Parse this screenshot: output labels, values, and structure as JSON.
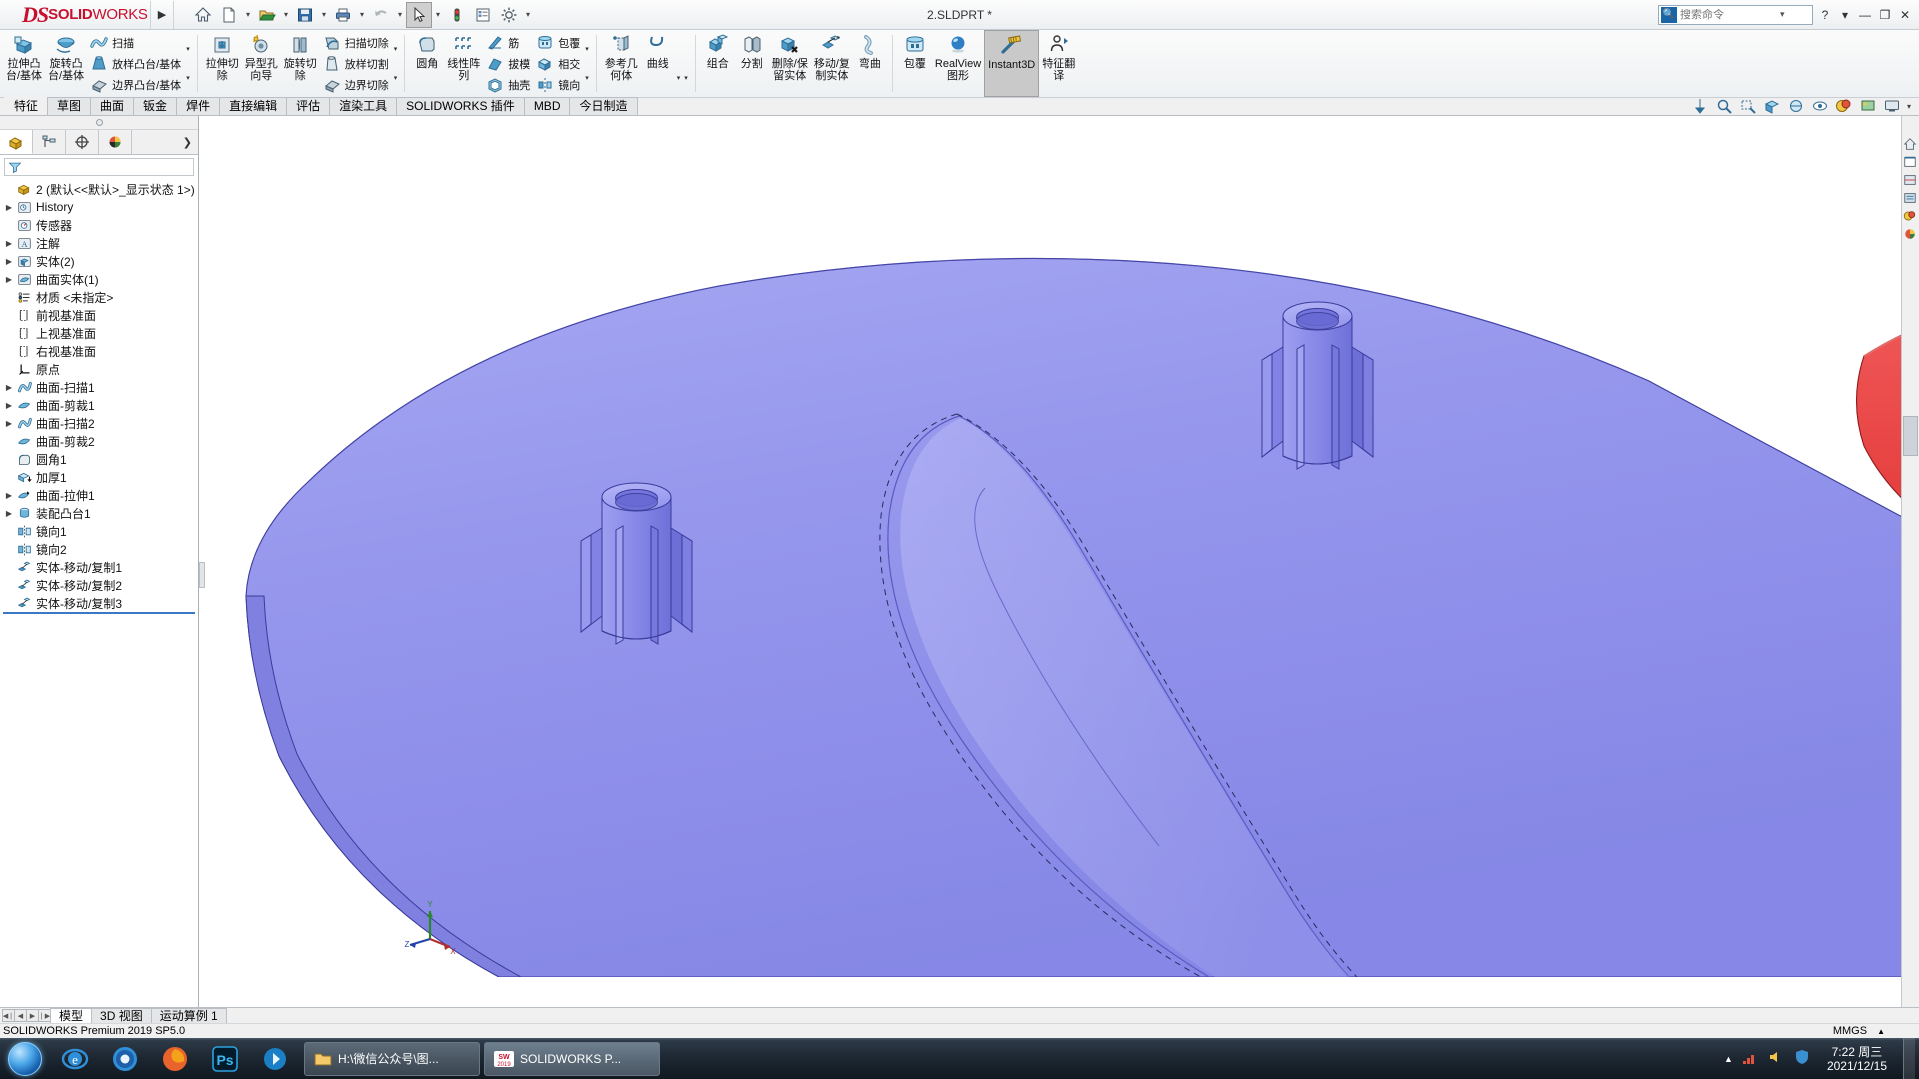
{
  "titlebar": {
    "brand_ds": "DS",
    "brand_bold": "SOLID",
    "brand_thin": "WORKS",
    "expand_arrow": "▶",
    "document_title": "2.SLDPRT *",
    "buttons": [
      {
        "name": "home-button",
        "icon": "home-icon",
        "caret": false
      },
      {
        "name": "new-document-button",
        "icon": "new-doc-icon",
        "caret": true
      },
      {
        "name": "open-document-button",
        "icon": "open-folder-icon",
        "caret": true
      },
      {
        "name": "save-button",
        "icon": "save-floppy-icon",
        "caret": true
      },
      {
        "name": "print-button",
        "icon": "printer-icon",
        "caret": true
      },
      {
        "name": "undo-button",
        "icon": "undo-arrow-icon",
        "caret": true
      },
      {
        "name": "select-button",
        "icon": "cursor-arrow-icon",
        "caret": true
      },
      {
        "name": "rebuild-button",
        "icon": "rebuild-traffic-icon",
        "caret": false
      },
      {
        "name": "options-properties-button",
        "icon": "properties-list-icon",
        "caret": false
      },
      {
        "name": "settings-button",
        "icon": "gear-icon",
        "caret": true
      }
    ],
    "search_placeholder": "搜索命令",
    "search_value": "",
    "help_label": "?",
    "help_caret": "▾",
    "minimize": "—",
    "maximize": "❐",
    "close": "✕"
  },
  "ribbon": {
    "groups": [
      {
        "name": "boss-base-group",
        "big": [
          {
            "name": "extruded-boss-base",
            "label": "拉伸凸\n台/基体",
            "icon": "extrude-boss-icon"
          },
          {
            "name": "revolved-boss-base",
            "label": "旋转凸\n台/基体",
            "icon": "revolve-boss-icon"
          }
        ],
        "rows": [
          {
            "name": "swept-boss-base",
            "label": "扫描",
            "icon": "sweep-icon"
          },
          {
            "name": "lofted-boss-base",
            "label": "放样凸台/基体",
            "icon": "loft-icon"
          },
          {
            "name": "boundary-boss-base",
            "label": "边界凸台/基体",
            "icon": "boundary-icon"
          }
        ]
      },
      {
        "name": "cut-group",
        "big": [
          {
            "name": "extruded-cut",
            "label": "拉伸切\n除",
            "icon": "extrude-cut-icon"
          },
          {
            "name": "hole-wizard",
            "label": "异型孔\n向导",
            "icon": "hole-wizard-icon"
          },
          {
            "name": "revolved-cut",
            "label": "旋转切\n除",
            "icon": "revolve-cut-icon"
          }
        ],
        "rows": [
          {
            "name": "swept-cut",
            "label": "扫描切除",
            "icon": "sweep-cut-icon"
          },
          {
            "name": "lofted-cut",
            "label": "放样切割",
            "icon": "loft-cut-icon"
          },
          {
            "name": "boundary-cut",
            "label": "边界切除",
            "icon": "boundary-cut-icon"
          }
        ]
      },
      {
        "name": "feature-group",
        "big": [
          {
            "name": "fillet",
            "label": "圆角",
            "icon": "fillet-icon"
          },
          {
            "name": "linear-pattern",
            "label": "线性阵\n列",
            "icon": "linear-pattern-icon"
          }
        ],
        "rows": [
          {
            "name": "rib",
            "label": "筋",
            "icon": "rib-icon"
          },
          {
            "name": "draft",
            "label": "拔模",
            "icon": "draft-icon"
          },
          {
            "name": "shell",
            "label": "抽壳",
            "icon": "shell-icon"
          }
        ],
        "rows2": [
          {
            "name": "wrap",
            "label": "包覆",
            "icon": "wrap-icon"
          },
          {
            "name": "intersect",
            "label": "相交",
            "icon": "intersect-icon"
          },
          {
            "name": "mirror",
            "label": "镜向",
            "icon": "mirror-icon"
          }
        ]
      },
      {
        "name": "reference-group",
        "big": [
          {
            "name": "reference-geometry",
            "label": "参考几\n何体",
            "icon": "reference-geometry-icon"
          },
          {
            "name": "curves",
            "label": "曲线",
            "icon": "curve-icon"
          }
        ]
      },
      {
        "name": "body-group",
        "big": [
          {
            "name": "combine",
            "label": "组合",
            "icon": "combine-icon"
          },
          {
            "name": "split",
            "label": "分割",
            "icon": "split-icon"
          },
          {
            "name": "delete-keep-body",
            "label": "删除/保\n留实体",
            "icon": "delete-body-icon"
          },
          {
            "name": "move-copy-body",
            "label": "移动/复\n制实体",
            "icon": "move-copy-icon"
          },
          {
            "name": "flex",
            "label": "弯曲",
            "icon": "flex-icon"
          }
        ]
      },
      {
        "name": "display-group",
        "big": [
          {
            "name": "wrap2",
            "label": "包覆",
            "icon": "wrap-icon"
          },
          {
            "name": "realview-graphics",
            "label": "RealView\n图形",
            "icon": "realview-icon"
          },
          {
            "name": "instant3d",
            "label": "Instant3D",
            "icon": "instant3d-icon",
            "active": true
          },
          {
            "name": "feature-translate",
            "label": "特征翻\n译",
            "icon": "feature-translate-icon"
          }
        ]
      }
    ]
  },
  "command_tabs": {
    "items": [
      {
        "name": "tab-features",
        "label": "特征",
        "selected": true
      },
      {
        "name": "tab-sketch",
        "label": "草图",
        "selected": false
      },
      {
        "name": "tab-surfaces",
        "label": "曲面",
        "selected": false
      },
      {
        "name": "tab-sheetmetal",
        "label": "钣金",
        "selected": false
      },
      {
        "name": "tab-weldments",
        "label": "焊件",
        "selected": false
      },
      {
        "name": "tab-direct-edit",
        "label": "直接编辑",
        "selected": false
      },
      {
        "name": "tab-evaluate",
        "label": "评估",
        "selected": false
      },
      {
        "name": "tab-render-tools",
        "label": "渲染工具",
        "selected": false
      },
      {
        "name": "tab-sw-addins",
        "label": "SOLIDWORKS 插件",
        "selected": false
      },
      {
        "name": "tab-mbd",
        "label": "MBD",
        "selected": false
      },
      {
        "name": "tab-today-manufacturing",
        "label": "今日制造",
        "selected": false
      }
    ]
  },
  "view_toolbar": {
    "items": [
      {
        "name": "section-view-icon"
      },
      {
        "name": "zoom-to-fit-icon"
      },
      {
        "name": "zoom-area-icon"
      },
      {
        "name": "view-orientation-icon"
      },
      {
        "name": "display-style-icon"
      },
      {
        "name": "hide-show-icon"
      },
      {
        "name": "edit-appearance-icon"
      },
      {
        "name": "apply-scene-icon"
      },
      {
        "name": "view-settings-icon"
      }
    ]
  },
  "feature_manager": {
    "tabs": [
      {
        "name": "fm-tab-feature-tree",
        "icon": "feature-tree-icon",
        "selected": true
      },
      {
        "name": "fm-tab-property-manager",
        "icon": "property-manager-icon",
        "selected": false
      },
      {
        "name": "fm-tab-configuration-manager",
        "icon": "configuration-icon",
        "selected": false
      },
      {
        "name": "fm-tab-display-manager",
        "icon": "display-manager-icon",
        "selected": false
      }
    ],
    "expand_arrow": "❯",
    "filter_placeholder": "",
    "tree": [
      {
        "name": "tree-root",
        "label": "2  (默认<<默认>_显示状态 1>)",
        "icon": "part-icon",
        "indent": 0,
        "expandable": false
      },
      {
        "name": "tree-history",
        "label": "History",
        "icon": "history-icon",
        "indent": 1,
        "expandable": true
      },
      {
        "name": "tree-sensors",
        "label": "传感器",
        "icon": "sensor-icon",
        "indent": 1,
        "expandable": false
      },
      {
        "name": "tree-annotations",
        "label": "注解",
        "icon": "annotation-icon",
        "indent": 1,
        "expandable": true
      },
      {
        "name": "tree-solid-bodies",
        "label": "实体(2)",
        "icon": "solid-bodies-icon",
        "indent": 1,
        "expandable": true
      },
      {
        "name": "tree-surface-bodies",
        "label": "曲面实体(1)",
        "icon": "surface-bodies-icon",
        "indent": 1,
        "expandable": true
      },
      {
        "name": "tree-material",
        "label": "材质 <未指定>",
        "icon": "material-icon",
        "indent": 1,
        "expandable": false
      },
      {
        "name": "tree-front-plane",
        "label": "前视基准面",
        "icon": "plane-icon",
        "indent": 1,
        "expandable": false
      },
      {
        "name": "tree-top-plane",
        "label": "上视基准面",
        "icon": "plane-icon",
        "indent": 1,
        "expandable": false
      },
      {
        "name": "tree-right-plane",
        "label": "右视基准面",
        "icon": "plane-icon",
        "indent": 1,
        "expandable": false
      },
      {
        "name": "tree-origin",
        "label": "原点",
        "icon": "origin-icon",
        "indent": 1,
        "expandable": false
      },
      {
        "name": "tree-surface-sweep1",
        "label": "曲面-扫描1",
        "icon": "surface-sweep-icon",
        "indent": 1,
        "expandable": true
      },
      {
        "name": "tree-surface-trim1",
        "label": "曲面-剪裁1",
        "icon": "surface-trim-icon",
        "indent": 1,
        "expandable": true
      },
      {
        "name": "tree-surface-sweep2",
        "label": "曲面-扫描2",
        "icon": "surface-sweep-icon",
        "indent": 1,
        "expandable": true
      },
      {
        "name": "tree-surface-trim2",
        "label": "曲面-剪裁2",
        "icon": "surface-trim-icon",
        "indent": 1,
        "expandable": false
      },
      {
        "name": "tree-fillet1",
        "label": "圆角1",
        "icon": "fillet-tree-icon",
        "indent": 1,
        "expandable": false
      },
      {
        "name": "tree-thicken1",
        "label": "加厚1",
        "icon": "thicken-icon",
        "indent": 1,
        "expandable": false
      },
      {
        "name": "tree-surface-extrude1",
        "label": "曲面-拉伸1",
        "icon": "surface-extrude-icon",
        "indent": 1,
        "expandable": true
      },
      {
        "name": "tree-assembly-boss1",
        "label": "装配凸台1",
        "icon": "boss-tree-icon",
        "indent": 1,
        "expandable": true
      },
      {
        "name": "tree-mirror1",
        "label": "镜向1",
        "icon": "mirror-tree-icon",
        "indent": 1,
        "expandable": false
      },
      {
        "name": "tree-mirror2",
        "label": "镜向2",
        "icon": "mirror-tree-icon",
        "indent": 1,
        "expandable": false
      },
      {
        "name": "tree-body-move-copy1",
        "label": "实体-移动/复制1",
        "icon": "move-copy-tree-icon",
        "indent": 1,
        "expandable": false
      },
      {
        "name": "tree-body-move-copy2",
        "label": "实体-移动/复制2",
        "icon": "move-copy-tree-icon",
        "indent": 1,
        "expandable": false
      },
      {
        "name": "tree-body-move-copy3",
        "label": "实体-移动/复制3",
        "icon": "move-copy-tree-icon",
        "indent": 1,
        "expandable": false
      }
    ]
  },
  "graphics": {
    "triad_labels": {
      "x": "X",
      "y": "Y",
      "z": "Z"
    },
    "model_color": "#8e8fe8",
    "model_color_light": "#a9aaf0",
    "secondary_body_color": "#f04040",
    "right_toolbar": [
      {
        "name": "view-home-icon"
      },
      {
        "name": "view-previous-icon"
      },
      {
        "name": "view-section-icon"
      },
      {
        "name": "view-display-icon"
      },
      {
        "name": "view-appearance-icon"
      },
      {
        "name": "view-scene-icon"
      }
    ]
  },
  "bottom_tabs": {
    "nav": [
      "◀❘",
      "◀",
      "▶",
      "❘▶"
    ],
    "items": [
      {
        "name": "btab-model",
        "label": "模型",
        "selected": true
      },
      {
        "name": "btab-3dviews",
        "label": "3D 视图",
        "selected": false
      },
      {
        "name": "btab-motion-study",
        "label": "运动算例 1",
        "selected": false
      }
    ]
  },
  "statusbar": {
    "left_text": "SOLIDWORKS Premium 2019 SP5.0",
    "units": "MMGS",
    "units_caret": "▲",
    "editing": ""
  },
  "taskbar": {
    "pinned": [
      {
        "name": "taskbar-ie-icon",
        "icon": "ie"
      },
      {
        "name": "taskbar-chrome-icon",
        "icon": "chrome"
      },
      {
        "name": "taskbar-firefox-icon",
        "icon": "firefox"
      },
      {
        "name": "taskbar-photoshop-icon",
        "icon": "ps"
      },
      {
        "name": "taskbar-media-icon",
        "icon": "media"
      }
    ],
    "windows": [
      {
        "name": "taskbar-window-explorer",
        "label": "H:\\微信公众号\\图...",
        "icon": "folder"
      },
      {
        "name": "taskbar-window-solidworks",
        "label": "SOLIDWORKS P...",
        "icon": "sw",
        "active": true
      }
    ],
    "tray_icons": [
      {
        "name": "tray-network-icon"
      },
      {
        "name": "tray-volume-icon"
      },
      {
        "name": "tray-security-icon"
      }
    ],
    "clock_time": "7:22 周三",
    "clock_date": "2021/12/15"
  }
}
